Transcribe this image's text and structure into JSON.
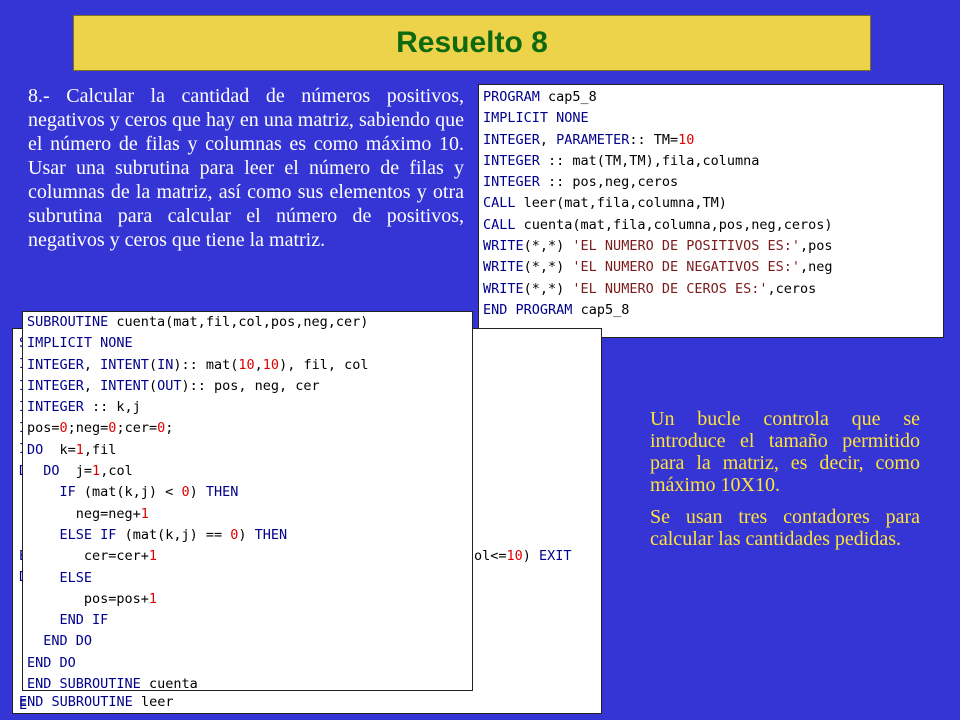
{
  "title": "Resuelto 8",
  "statement": "8.- Calcular la cantidad de números positivos, negativos y ceros que hay en una matriz, sabiendo que el número de filas y columnas es como máximo 10. Usar una subrutina para leer el número de filas y columnas de la matriz, así como sus elementos y otra subrutina para calcular el número de positivos, negativos y ceros que tiene la matriz.",
  "side_notes": [
    "Un bucle controla que se introduce el tamaño permitido para la matriz, es decir, como máximo 10X10.",
    "Se usan tres contadores para calcular las cantidades pedidas."
  ],
  "program_code": [
    "PROGRAM cap5_8",
    "IMPLICIT NONE",
    "INTEGER, PARAMETER:: TM=10",
    "INTEGER :: mat(TM,TM),fila,columna",
    "INTEGER :: pos,neg,ceros",
    "CALL leer(mat,fila,columna,TM)",
    "CALL cuenta(mat,fila,columna,pos,neg,ceros)",
    "WRITE(*,*) 'EL NUMERO DE POSITIVOS ES:',pos",
    "WRITE(*,*) 'EL NUMERO DE NEGATIVOS ES:',neg",
    "WRITE(*,*) 'EL NUMERO DE CEROS ES:',ceros",
    "END PROGRAM cap5_8"
  ],
  "leer_code_visible": {
    "left_fragments": [
      "S",
      "I",
      "I",
      "I",
      "I",
      "I",
      "D",
      "",
      "",
      "",
      "E",
      "D",
      "",
      "",
      "",
      "",
      "",
      "E"
    ],
    "right_fragment": "ol<=10) EXIT",
    "last_line": "END SUBROUTINE leer"
  },
  "cuenta_code": [
    "SUBROUTINE cuenta(mat,fil,col,pos,neg,cer)",
    "IMPLICIT NONE",
    "INTEGER, INTENT(IN):: mat(10,10), fil, col",
    "INTEGER, INTENT(OUT):: pos, neg, cer",
    "INTEGER :: k,j",
    "pos=0;neg=0;cer=0;",
    "DO  k=1,fil",
    "  DO  j=1,col",
    "    IF (mat(k,j) < 0) THEN",
    "      neg=neg+1",
    "    ELSE IF (mat(k,j) == 0) THEN",
    "       cer=cer+1",
    "    ELSE",
    "       pos=pos+1",
    "    END IF",
    "  END DO",
    "END DO",
    "END SUBROUTINE cuenta"
  ],
  "colors": {
    "background": "#3535d6",
    "title_bg": "#ecd34a",
    "title_text": "#0f6a0f",
    "statement_text": "#ffffff",
    "note_text": "#ffe23a",
    "keyword": "#00008b",
    "number": "#e00000"
  }
}
